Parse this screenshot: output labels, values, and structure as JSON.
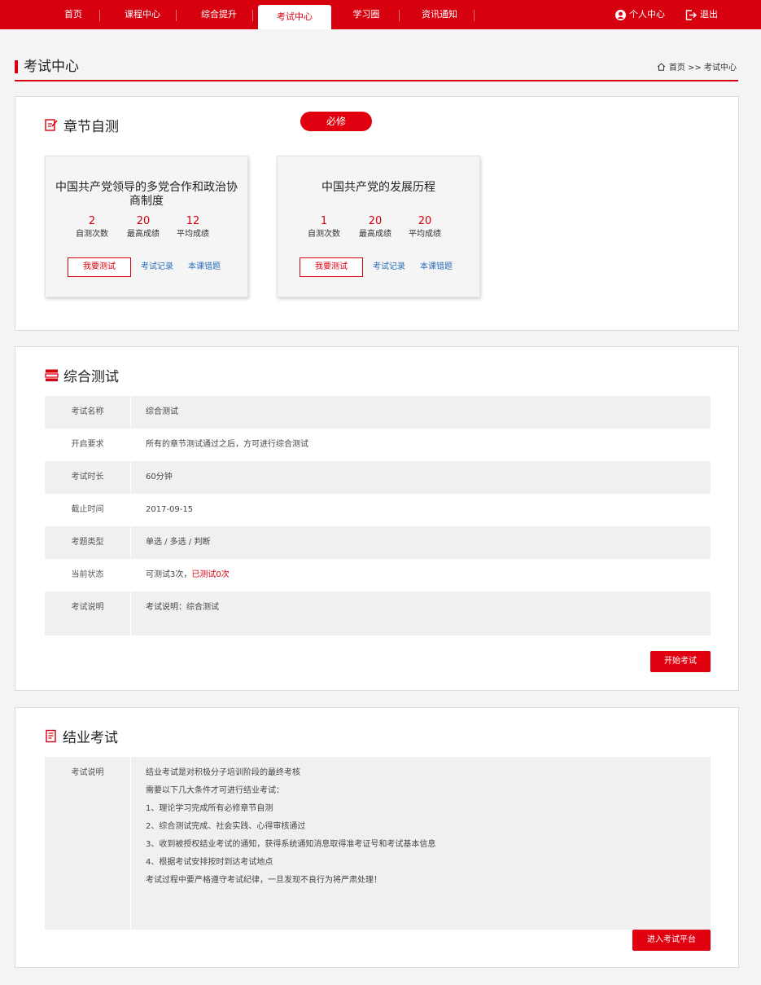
{
  "nav": {
    "items": [
      "首页",
      "课程中心",
      "综合提升",
      "考试中心",
      "学习圈",
      "资讯通知"
    ],
    "active": "考试中心",
    "user_center": "个人中心",
    "logout": "退出"
  },
  "page": {
    "title": "考试中心",
    "breadcrumb": "首页 >> 考试中心"
  },
  "chapter_test": {
    "title": "章节自测",
    "badge": "必修",
    "courses": [
      {
        "name": "中国共产党领导的多党合作和政治协商制度",
        "self_test_count": "2",
        "max_score": "20",
        "avg_score": "12",
        "self_test_label": "自测次数",
        "max_label": "最高成绩",
        "avg_label": "平均成绩",
        "test_button": "我要测试",
        "record_link": "考试记录",
        "mistakes_link": "本课错题"
      },
      {
        "name": "中国共产党的发展历程",
        "self_test_count": "1",
        "max_score": "20",
        "avg_score": "20",
        "self_test_label": "自测次数",
        "max_label": "最高成绩",
        "avg_label": "平均成绩",
        "test_button": "我要测试",
        "record_link": "考试记录",
        "mistakes_link": "本课错题"
      }
    ]
  },
  "comprehensive": {
    "title": "综合测试",
    "rows": [
      {
        "key": "考试名称",
        "value": "综合测试"
      },
      {
        "key": "开启要求",
        "value": "所有的章节测试通过之后，方可进行综合测试"
      },
      {
        "key": "考试时长",
        "value": "60分钟"
      },
      {
        "key": "截止时间",
        "value": "2017-09-15"
      },
      {
        "key": "考题类型",
        "value": "单选 / 多选 / 判断"
      },
      {
        "key": "当前状态",
        "value": "可测试3次，",
        "value_red": "已测试0次"
      },
      {
        "key": "考试说明",
        "value": "考试说明：综合测试"
      }
    ],
    "start_button": "开始考试"
  },
  "final_exam": {
    "title": "结业考试",
    "key": "考试说明",
    "lines": [
      "结业考试是对积极分子培训阶段的最终考核",
      "需要以下几大条件才可进行结业考试：",
      "1、理论学习完成所有必修章节自测",
      "2、综合测试完成、社会实践、心得审核通过",
      "3、收到被授权结业考试的通知，获得系统通知消息取得准考证号和考试基本信息",
      "4、根据考试安排按时到达考试地点",
      "考试过程中要严格遵守考试纪律，一旦发现不良行为将严肃处理！"
    ],
    "enter_button": "进入考试平台"
  },
  "colors": {
    "brand_red": "#d7000f",
    "link_blue": "#2a6fba"
  }
}
